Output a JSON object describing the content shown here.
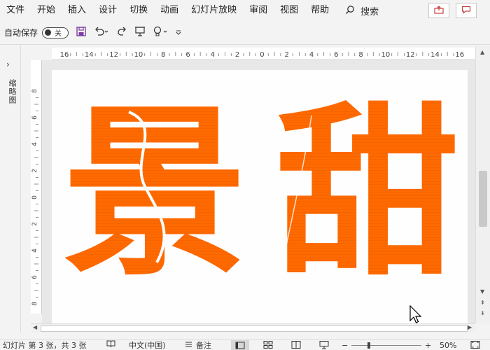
{
  "menu": {
    "items": [
      "文件",
      "开始",
      "插入",
      "设计",
      "切换",
      "动画",
      "幻灯片放映",
      "审阅",
      "视图",
      "帮助"
    ],
    "search_label": "搜索",
    "icons": [
      "search-icon",
      "share-icon",
      "comment-icon"
    ]
  },
  "qat": {
    "autosave_label": "自动保存",
    "autosave_state": "关",
    "icons": [
      "save-icon",
      "undo-icon",
      "redo-icon",
      "present-icon",
      "lightbulb-icon",
      "customize-icon"
    ]
  },
  "sidebar": {
    "expand_icon": "chevron-right-icon",
    "label": "缩略图"
  },
  "rulers": {
    "horizontal": [
      "16",
      "14",
      "12",
      "10",
      "8",
      "6",
      "4",
      "2",
      "0",
      "2",
      "4",
      "6",
      "8",
      "10",
      "12",
      "14",
      "16"
    ],
    "vertical": [
      "8",
      "6",
      "4",
      "2",
      "0",
      "2",
      "4",
      "6",
      "8"
    ]
  },
  "slide": {
    "char1": "景",
    "char2": "甜",
    "text_color": "#ff6a00"
  },
  "statusbar": {
    "slide_info": "幻灯片 第 3 张，共 3 张",
    "language": "中文(中国)",
    "notes": "备注",
    "zoom_minus": "−",
    "zoom_plus": "+",
    "zoom": "50%",
    "icons": [
      "accessibility-icon",
      "notes-icon",
      "normal-view-icon",
      "slide-sorter-icon",
      "reading-view-icon",
      "slideshow-icon",
      "fit-slide-icon"
    ]
  },
  "colors": {
    "accent_save": "#7b3fa0",
    "accent_red": "#c43e3e",
    "chrome": "#f3f3f3"
  }
}
